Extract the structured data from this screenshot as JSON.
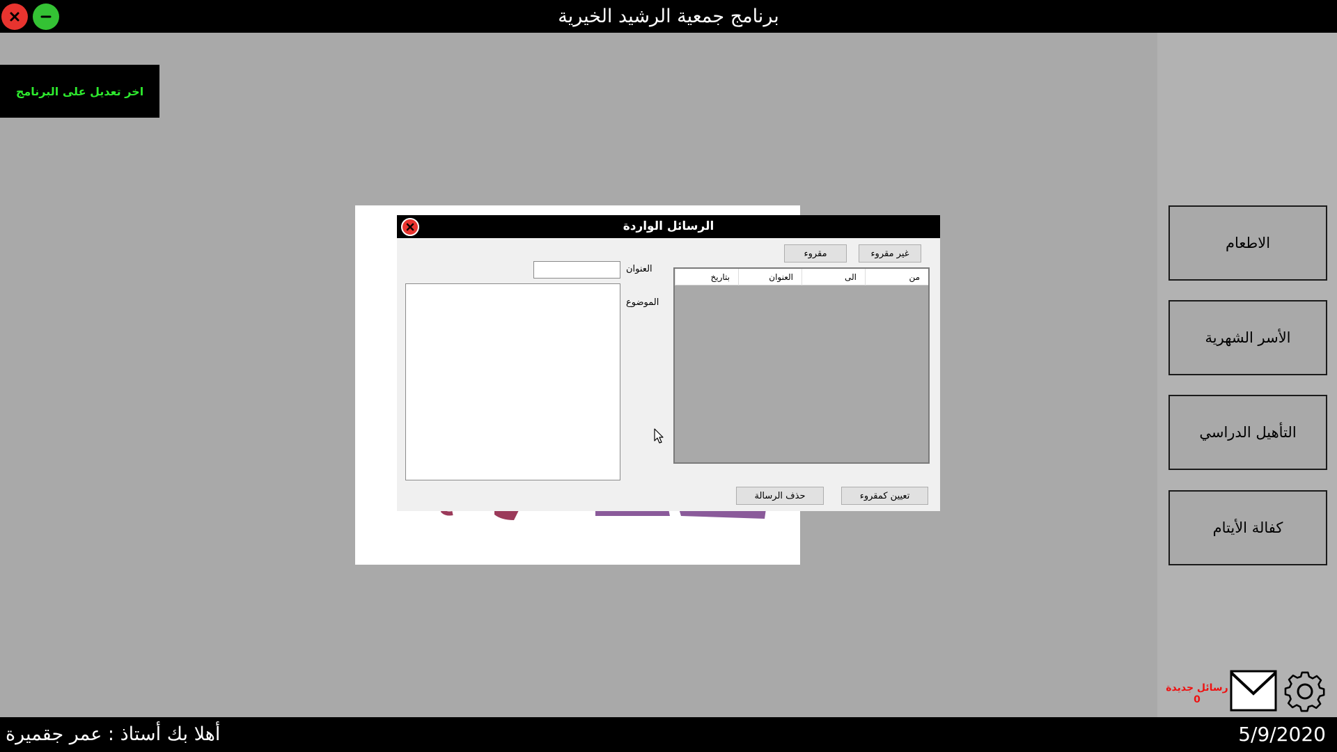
{
  "titlebar": {
    "title": "برنامج جمعية الرشيد الخيرية",
    "close_icon": "close-icon",
    "minimize_icon": "minimize-icon"
  },
  "last_update_label": "اخر تعديل على البرنامج",
  "menu": {
    "items": [
      {
        "label": "الاطعام"
      },
      {
        "label": "الأسر الشهرية"
      },
      {
        "label": "التأهيل الدراسي"
      },
      {
        "label": "كفالة الأيتام"
      }
    ]
  },
  "messages": {
    "new_label": "رسائل جديدة",
    "new_count": "0"
  },
  "status": {
    "welcome": "أهلا بك أستاذ : عمر جقميرة",
    "date": "5/9/2020"
  },
  "dialog": {
    "title": "الرسائل الواردة",
    "filter_unread": "غير مقروء",
    "filter_read": "مقروء",
    "columns": [
      "من",
      "الى",
      "العنوان",
      "بتاريخ"
    ],
    "subject_label": "العنوان",
    "subject_value": "",
    "body_label": "الموضوع",
    "body_value": "",
    "mark_read": "تعيين كمقروء",
    "delete_message": "حذف الرسالة"
  },
  "colors": {
    "accent_green": "#2eea2e",
    "close_red": "#e8342f",
    "minimize_green": "#34c234",
    "alert_red": "#ee1111",
    "background": "#a9a9a9"
  }
}
